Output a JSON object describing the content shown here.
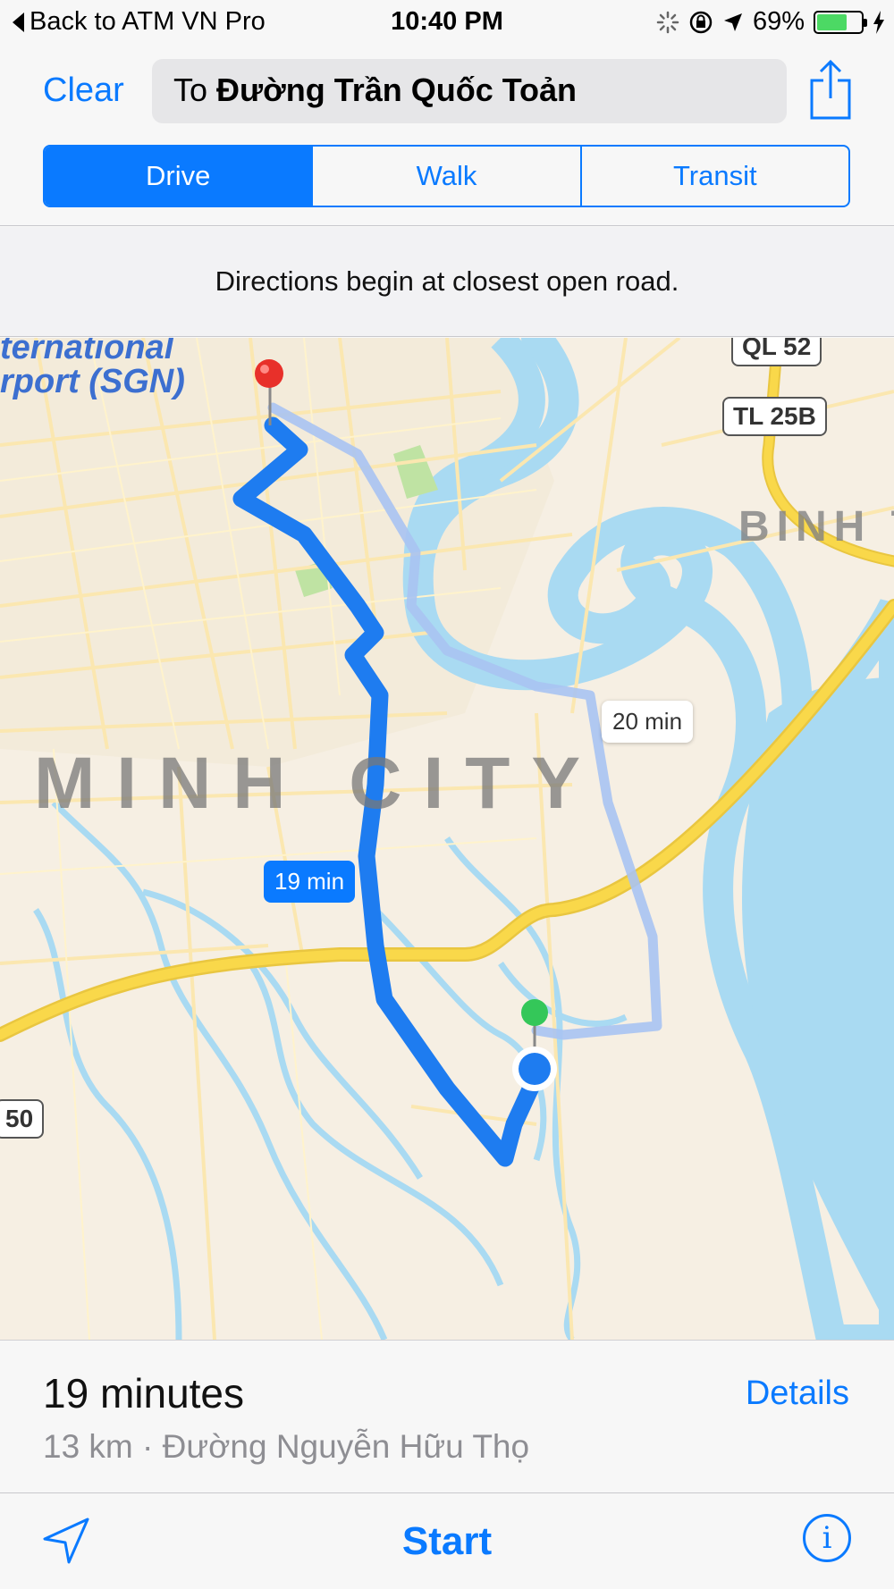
{
  "status_bar": {
    "back_label": "Back to ATM VN Pro",
    "time": "10:40 PM",
    "battery": "69%",
    "battery_level": 0.69
  },
  "header": {
    "clear_label": "Clear",
    "destination_prefix": "To",
    "destination_name": "Đường Trần Quốc Toản",
    "share_icon": "share-icon"
  },
  "modes": [
    {
      "label": "Drive",
      "active": true
    },
    {
      "label": "Walk",
      "active": false
    },
    {
      "label": "Transit",
      "active": false
    }
  ],
  "notice": "Directions begin at closest open road.",
  "map": {
    "labels": {
      "airport_line1": "ternational",
      "airport_line2": "rport (SGN)",
      "city": "MINH CITY",
      "district": "BINH T"
    },
    "shields": [
      "QL 52",
      "TL 25B",
      "50"
    ],
    "alt_route_time": "20 min",
    "main_route_time": "19 min",
    "colors": {
      "route_main": "#1e7cf0",
      "route_alt": "#a9c3f2",
      "water": "#a9daf2",
      "highway": "#f9d84a",
      "land": "#f6efe3"
    }
  },
  "route": {
    "duration": "19 minutes",
    "summary": "13 km · Đường Nguyễn Hữu Thọ",
    "details_label": "Details"
  },
  "toolbar": {
    "start_label": "Start",
    "location_icon": "location-arrow-icon",
    "info_icon": "info-icon",
    "info_glyph": "i"
  },
  "colors": {
    "accent": "#0a7aff",
    "secondary_text": "#8e8e93"
  }
}
